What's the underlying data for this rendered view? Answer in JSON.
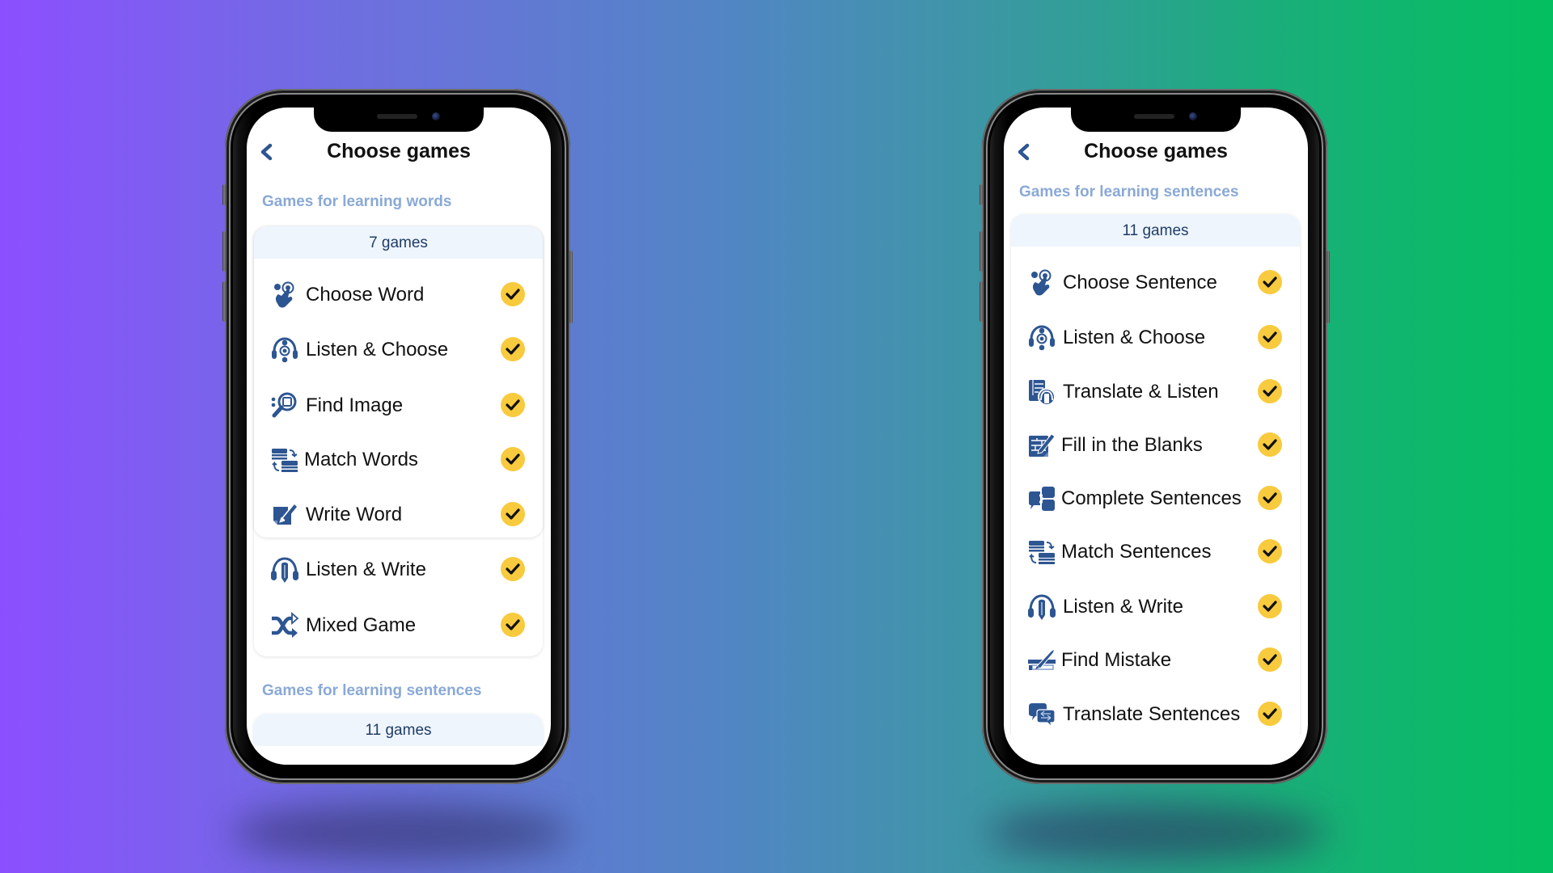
{
  "background": {
    "gradient_colors": [
      "#8c4fff",
      "#5186c4",
      "#03bf5f"
    ]
  },
  "colors": {
    "icon": "#2d5592",
    "check_badge": "#f8ca3d",
    "section_label": "#8aa9d6",
    "card_header_bg": "#eef5fd",
    "card_header_text": "#1f3d66"
  },
  "phones": [
    {
      "header": {
        "title": "Choose games",
        "back_icon": "chevron-left-icon"
      },
      "sections": [
        {
          "label": "Games for learning words",
          "count_label": "7 games",
          "games": [
            {
              "label": "Choose Word",
              "icon": "tap-finger-icon",
              "selected": true
            },
            {
              "label": "Listen & Choose",
              "icon": "headphones-choose-icon",
              "selected": true
            },
            {
              "label": "Find Image",
              "icon": "magnifier-image-icon",
              "selected": true
            },
            {
              "label": "Match Words",
              "icon": "match-cards-icon",
              "selected": true
            },
            {
              "label": "Write Word",
              "icon": "write-note-icon",
              "selected": true
            },
            {
              "label": "Listen & Write",
              "icon": "headphones-pencil-icon",
              "selected": true
            },
            {
              "label": "Mixed Game",
              "icon": "shuffle-icon",
              "selected": true
            }
          ]
        },
        {
          "label": "Games for learning sentences",
          "count_label": "11 games",
          "games": []
        }
      ]
    },
    {
      "header": {
        "title": "Choose games",
        "back_icon": "chevron-left-icon"
      },
      "sections": [
        {
          "label": "Games for learning sentences",
          "count_label": "11 games",
          "games": [
            {
              "label": "Choose Sentence",
              "icon": "tap-finger-icon",
              "selected": true
            },
            {
              "label": "Listen & Choose",
              "icon": "headphones-choose-icon",
              "selected": true
            },
            {
              "label": "Translate & Listen",
              "icon": "translate-listen-icon",
              "selected": true
            },
            {
              "label": "Fill in the Blanks",
              "icon": "fill-blanks-icon",
              "selected": true
            },
            {
              "label": "Complete Sentences",
              "icon": "puzzle-chat-icon",
              "selected": true
            },
            {
              "label": "Match Sentences",
              "icon": "match-cards-icon",
              "selected": true
            },
            {
              "label": "Listen & Write",
              "icon": "headphones-pencil-icon",
              "selected": true
            },
            {
              "label": "Find Mistake",
              "icon": "pen-strike-icon",
              "selected": true
            },
            {
              "label": "Translate Sentences",
              "icon": "chat-translate-icon",
              "selected": true
            }
          ]
        }
      ]
    }
  ]
}
